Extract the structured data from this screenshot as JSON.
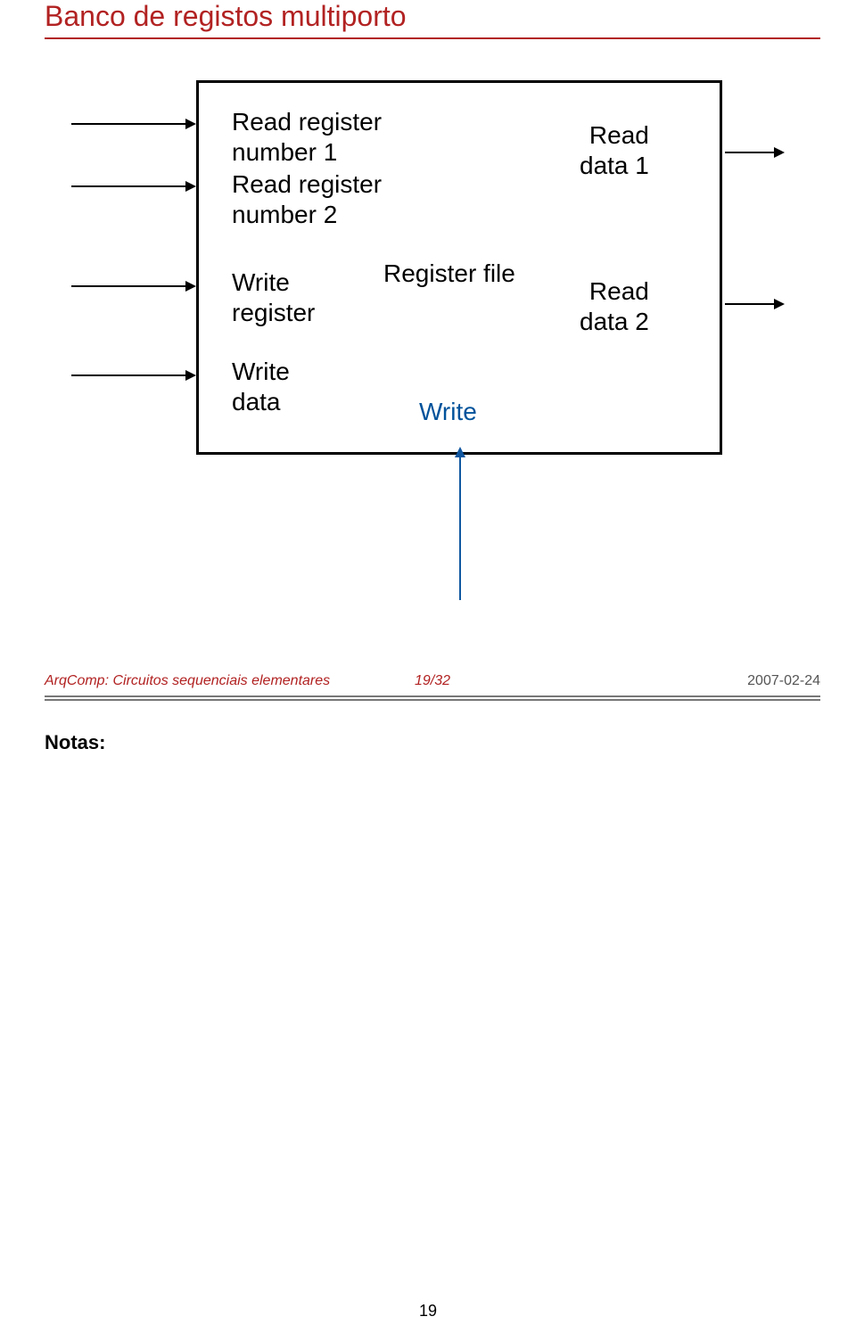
{
  "title": "Banco de registos multiporto",
  "diagram": {
    "read_reg_1": "Read register\nnumber 1",
    "read_reg_2": "Read register\nnumber 2",
    "write_reg": "Write\nregister",
    "write_data": "Write\ndata",
    "register_file": "Register file",
    "write_signal": "Write",
    "read_data_1": "Read\ndata 1",
    "read_data_2": "Read\ndata 2"
  },
  "footer": {
    "left": "ArqComp: Circuitos sequenciais elementares",
    "center": "19/32",
    "right": "2007-02-24"
  },
  "notes_label": "Notas:",
  "page_number": "19"
}
